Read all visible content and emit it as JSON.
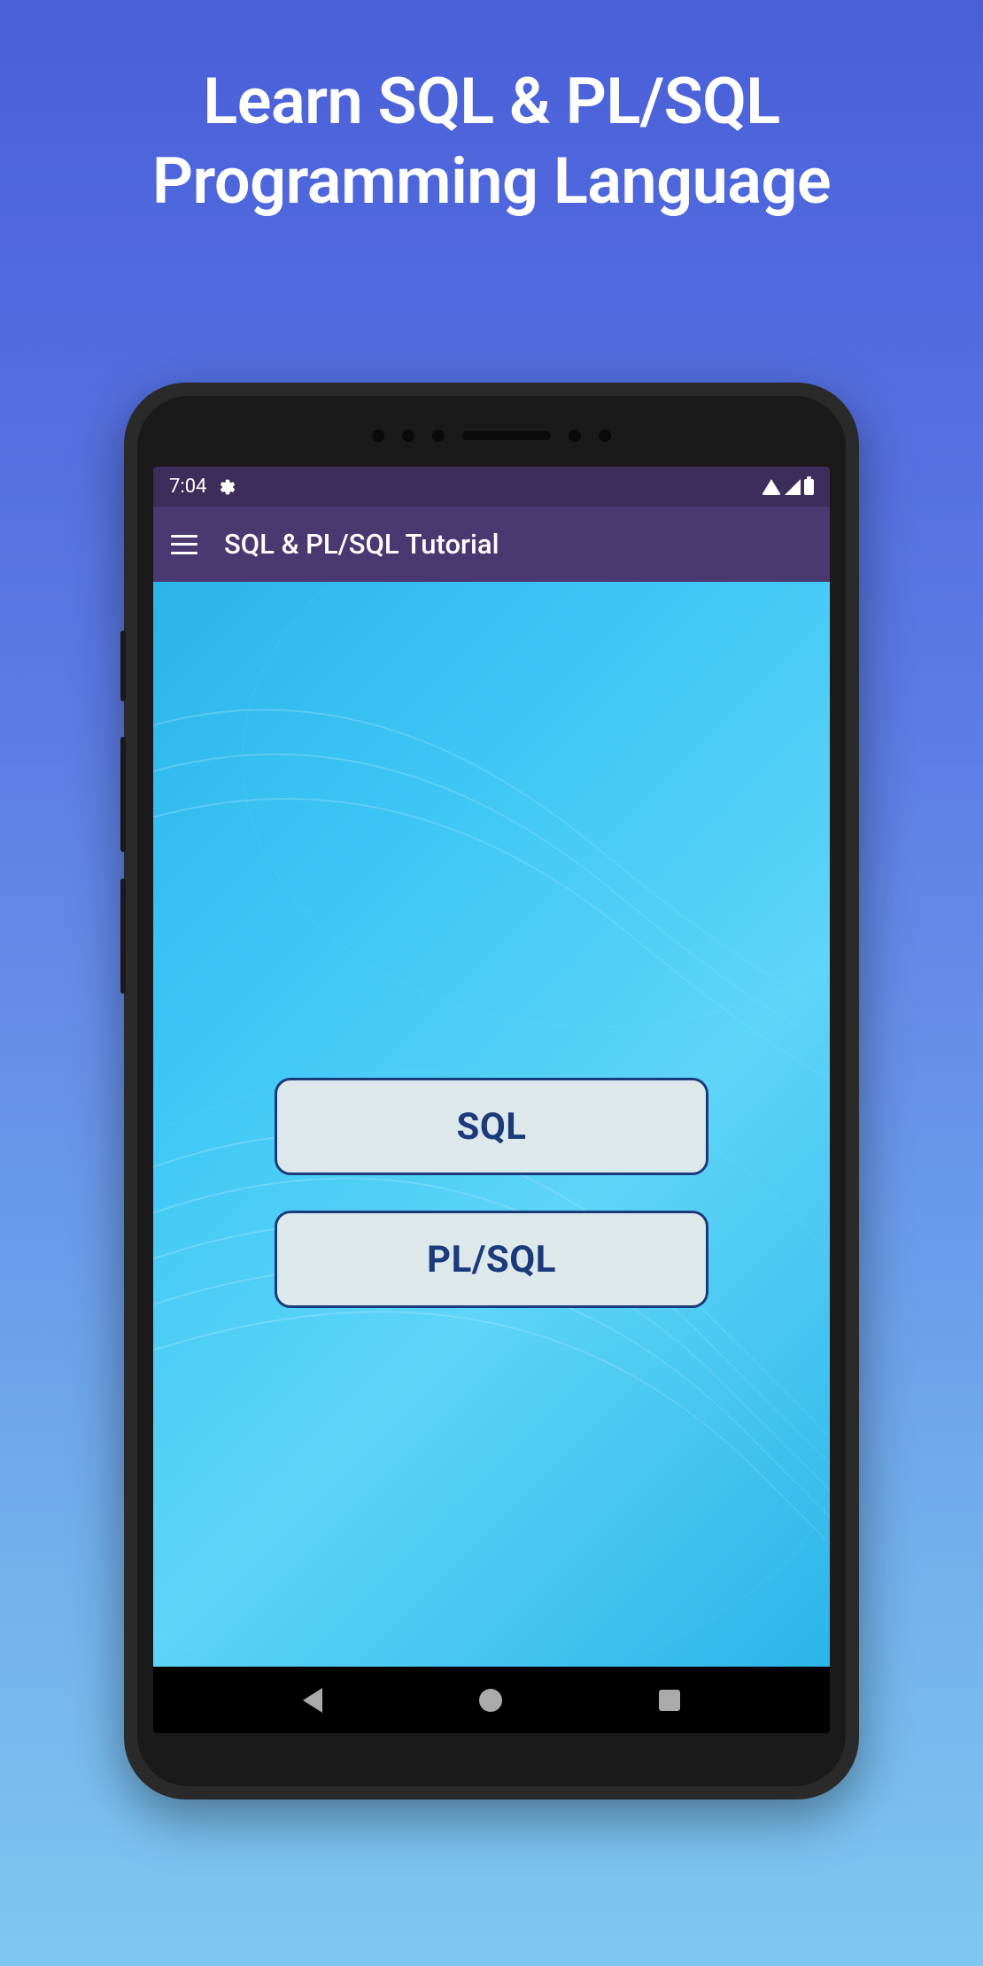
{
  "promo": {
    "line1": "Learn SQL & PL/SQL",
    "line2": "Programming Language"
  },
  "statusbar": {
    "time": "7:04"
  },
  "appbar": {
    "title": "SQL & PL/SQL Tutorial"
  },
  "main": {
    "buttons": [
      {
        "label": "SQL"
      },
      {
        "label": "PL/SQL"
      }
    ]
  }
}
